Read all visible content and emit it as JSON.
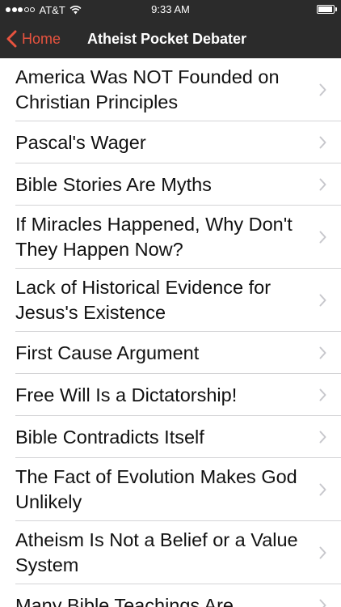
{
  "status_bar": {
    "carrier": "AT&T",
    "time": "9:33 AM",
    "signal_bars_filled": 3,
    "signal_bars_total": 5,
    "battery_level": 0.92,
    "icons": [
      "signal-dots-icon",
      "wifi-icon",
      "battery-icon"
    ]
  },
  "nav": {
    "back_label": "Home",
    "back_icon": "chevron-left-icon",
    "title": "Atheist Pocket Debater"
  },
  "colors": {
    "bar_background": "#2b2b2b",
    "accent": "#e8533f",
    "separator": "#d4d4d6",
    "chevron": "#c7c7cc",
    "text": "#111111"
  },
  "list": {
    "row_icon": "chevron-right-icon",
    "items": [
      {
        "label": "America Was NOT Founded on Christian Principles"
      },
      {
        "label": "Pascal's Wager"
      },
      {
        "label": "Bible Stories Are Myths"
      },
      {
        "label": "If Miracles Happened, Why Don't They Happen Now?"
      },
      {
        "label": "Lack of Historical Evidence for Jesus's Existence"
      },
      {
        "label": "First Cause Argument"
      },
      {
        "label": "Free Will Is a Dictatorship!"
      },
      {
        "label": "Bible Contradicts Itself"
      },
      {
        "label": "The Fact of Evolution Makes God Unlikely"
      },
      {
        "label": "Atheism Is Not a Belief or a Value System"
      },
      {
        "label": "Many Bible Teachings Are"
      }
    ]
  }
}
